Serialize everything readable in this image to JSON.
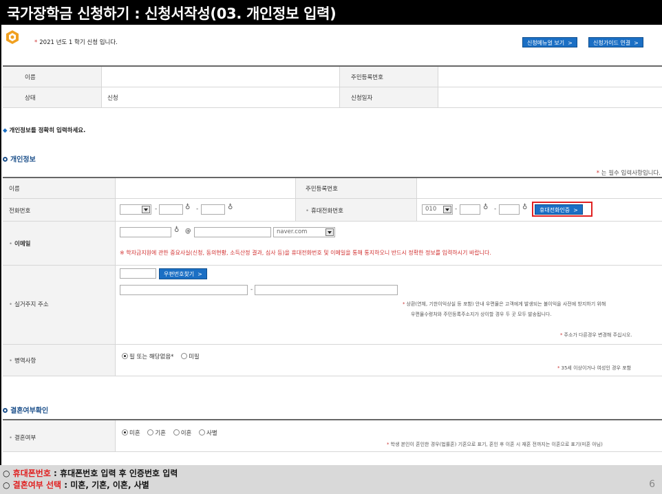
{
  "title": "국가장학금 신청하기 : 신청서작성(03. 개인정보 입력)",
  "notice": {
    "star": "*",
    "text": "2021 년도 1 학기 신청 입니다."
  },
  "top_buttons": {
    "manual": "신청메뉴얼 보기",
    "guide": "신청가이드 연결",
    "chevron": ">"
  },
  "summary": {
    "name_label": "이름",
    "name_value": "",
    "rrn_label": "주민등록번호",
    "rrn_value": "",
    "status_label": "상태",
    "status_value": "신청",
    "date_label": "신청일자",
    "date_value": ""
  },
  "guide": {
    "marker": "◆",
    "text": "개인정보를 정확히 입력하세요."
  },
  "personal": {
    "section_title": "개인정보",
    "required_note": {
      "star": "*",
      "text": " 는 필수 입력사항입니다."
    },
    "name_label": "이름",
    "rrn_label": "주민등록번호",
    "phone_label": "전화번호",
    "mobile_label": "휴대전화번호",
    "mobile_prefix": "010",
    "mobile_verify_btn": "휴대전화인증",
    "email_label": "이메일",
    "email_at": "@",
    "email_domain": "naver.com",
    "email_warning": "※ 학자금지원에 관한 중요사실(신청, 동의현황, 소득산정 결과, 심사 등)을 휴대전화번호 및 이메일을 통해 통지하오니 반드시 정확한 정보를 입력하시기 바랍니다.",
    "address_label": "실거주지 주소",
    "zipcode_btn": "우편번호찾기",
    "address_hint_1": "상환(연체, 기한이익상실 등 포함) 안내 우편물은 고객에게 발생되는 불이익을 사전에 방지하기 위해",
    "address_hint_2": "우편물수령처와 주민등록주소지가 상이할 경우 두 곳 모두 발송됩니다.",
    "address_hint_3": "주소가 다른경우 변경해 주십시오.",
    "military_label": "병역사항",
    "military_options": [
      "필 또는 해당없음*",
      "미필"
    ],
    "military_selected": 0,
    "military_hint": "35세 이상이거나 여성인 경우 포함"
  },
  "marriage": {
    "section_title": "결혼여부확인",
    "label": "결혼여부",
    "options": [
      "미혼",
      "기혼",
      "이혼",
      "사별"
    ],
    "selected": 0,
    "hint": "학생 본인이 혼인한 경우(법률혼) 기혼으로 표기, 혼인 후 이혼 시 재혼 전까지는 이혼으로 표기(미혼 아님)"
  },
  "footer": {
    "line1_mark": "○",
    "line1_red": "휴대폰번호",
    "line1_rest": " : 휴대폰번호 입력 후 인증번호 입력",
    "line2_mark": "○",
    "line2_red": "결혼여부 선택",
    "line2_rest": " : 미혼, 기혼, 이혼, 사별",
    "page": "6"
  },
  "colors": {
    "accent_blue": "#1b6fc4",
    "highlight_red": "#e02020",
    "section_blue": "#1b4f8a"
  }
}
